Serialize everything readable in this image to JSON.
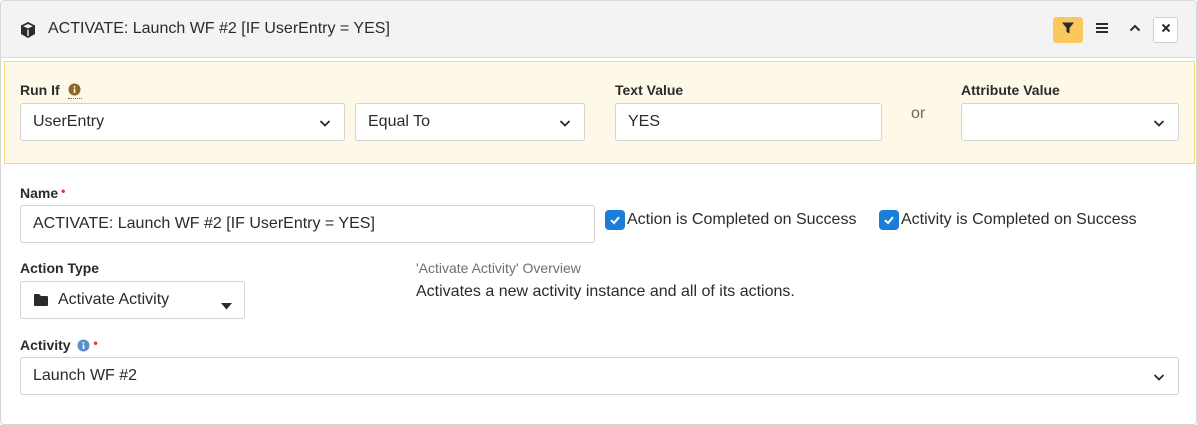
{
  "header": {
    "title": "ACTIVATE: Launch WF #2 [IF UserEntry = YES]",
    "icons": [
      "cube-icon",
      "filter-icon",
      "menu-icon",
      "chevron-up-icon",
      "close-icon"
    ]
  },
  "run_if": {
    "label": "Run If",
    "attribute_selected": "UserEntry",
    "comparison_selected": "Equal To",
    "text_value_label": "Text Value",
    "text_value": "YES",
    "or_label": "or",
    "attribute_value_label": "Attribute Value",
    "attribute_value_selected": ""
  },
  "name": {
    "label": "Name",
    "required_mark": "•",
    "value": "ACTIVATE: Launch WF #2 [IF UserEntry = YES]"
  },
  "checkboxes": {
    "action_completed_label": "Action is Completed on Success",
    "action_completed_checked": true,
    "activity_completed_label": "Activity is Completed on Success",
    "activity_completed_checked": true
  },
  "action_type": {
    "label": "Action Type",
    "selected": "Activate Activity",
    "overview_title": "'Activate Activity' Overview",
    "overview_description": "Activates a new activity instance and all of its actions."
  },
  "activity": {
    "label": "Activity",
    "required_mark": "•",
    "selected": "Launch WF #2"
  },
  "colors": {
    "accent_blue": "#1a7ed8",
    "filter_button": "#fbc85f",
    "run_if_background": "#fdf8e7",
    "required": "#d93a1a"
  }
}
